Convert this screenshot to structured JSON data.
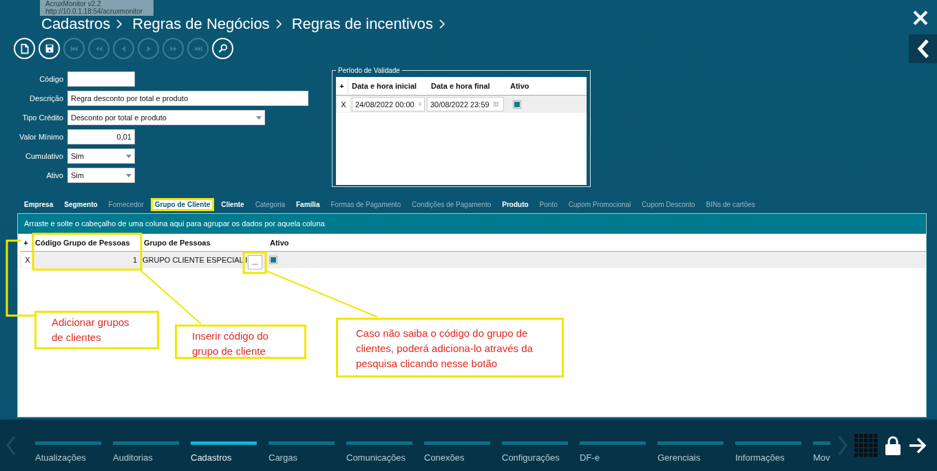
{
  "tooltip": {
    "title": "AcruxMonitor v2.2",
    "url": "http://10.0.1.18:54/acruxmonitor"
  },
  "breadcrumb": [
    "Cadastros",
    "Regras de Negócios",
    "Regras de incentivos"
  ],
  "toolbar": [
    {
      "kind": "new",
      "disabled": false
    },
    {
      "kind": "save",
      "disabled": false
    },
    {
      "kind": "first",
      "disabled": true
    },
    {
      "kind": "prev-page",
      "disabled": true
    },
    {
      "kind": "prev",
      "disabled": true
    },
    {
      "kind": "next",
      "disabled": true
    },
    {
      "kind": "next-page",
      "disabled": true
    },
    {
      "kind": "last",
      "disabled": true
    },
    {
      "kind": "search",
      "disabled": false
    }
  ],
  "form": [
    {
      "label": "Código",
      "kind": "text"
    },
    {
      "label": "Descrição",
      "kind": "text",
      "value": "Regra desconto por total e produto"
    },
    {
      "label": "Tipo Crédito",
      "kind": "select",
      "value": "Desconto por total e produto"
    },
    {
      "label": "Valor Mínimo",
      "kind": "number",
      "value": "0,01"
    },
    {
      "label": "Cumulativo",
      "kind": "select",
      "value": "Sim"
    },
    {
      "label": "Ativo",
      "kind": "select",
      "value": "Sim"
    }
  ],
  "validity": {
    "title": "Período de Validade",
    "add": "+",
    "columns": [
      "Data e hora inicial",
      "Data e hora final",
      "Ativo"
    ],
    "rows": [
      {
        "remove": "X",
        "start": "24/08/2022 00:00",
        "end": "30/08/2022 23:59",
        "active": true
      }
    ]
  },
  "tabs": [
    {
      "label": "Empresa",
      "selected": false,
      "disabled": false
    },
    {
      "label": "Segmento",
      "selected": false,
      "disabled": false
    },
    {
      "label": "Fornecedor",
      "selected": false,
      "disabled": true
    },
    {
      "label": "Grupo de Cliente",
      "selected": true,
      "disabled": false
    },
    {
      "label": "Cliente",
      "selected": false,
      "disabled": false
    },
    {
      "label": "Categoria",
      "selected": false,
      "disabled": true
    },
    {
      "label": "Família",
      "selected": false,
      "disabled": false
    },
    {
      "label": "Formas de Pagamento",
      "selected": false,
      "disabled": true
    },
    {
      "label": "Condições de Pagamento",
      "selected": false,
      "disabled": true
    },
    {
      "label": "Produto",
      "selected": false,
      "disabled": false
    },
    {
      "label": "Ponto",
      "selected": false,
      "disabled": true
    },
    {
      "label": "Cupom Promocional",
      "selected": false,
      "disabled": true
    },
    {
      "label": "Cupom Desconto",
      "selected": false,
      "disabled": true
    },
    {
      "label": "BINs de cartões",
      "selected": false,
      "disabled": true
    }
  ],
  "grid": {
    "group_hint": "Arraste e solte o cabeçalho de uma coluna aqui para agrupar os dados por aquela coluna",
    "add": "+",
    "columns": [
      "Código Grupo de Pessoas",
      "Grupo de Pessoas",
      "Ativo"
    ],
    "rows": [
      {
        "remove": "X",
        "code": "1",
        "group": "GRUPO CLIENTE ESPECIAL I",
        "lookup": "...",
        "active": true
      }
    ]
  },
  "annotations": [
    {
      "text": "Adicionar grupos de clientes"
    },
    {
      "text": "Inserir código do grupo de cliente"
    },
    {
      "text": "Caso não saiba o código do grupo de clientes, poderá adiciona-lo através da pesquisa clicando nesse botão"
    }
  ],
  "nav": [
    {
      "label": "Atualizações",
      "selected": false
    },
    {
      "label": "Auditorias",
      "selected": false
    },
    {
      "label": "Cadastros",
      "selected": true
    },
    {
      "label": "Cargas",
      "selected": false
    },
    {
      "label": "Comunicações",
      "selected": false
    },
    {
      "label": "Conexões",
      "selected": false
    },
    {
      "label": "Configurações",
      "selected": false
    },
    {
      "label": "DF-e",
      "selected": false
    },
    {
      "label": "Gerenciais",
      "selected": false
    },
    {
      "label": "Informações",
      "selected": false
    },
    {
      "label": "Mov",
      "selected": false
    }
  ]
}
